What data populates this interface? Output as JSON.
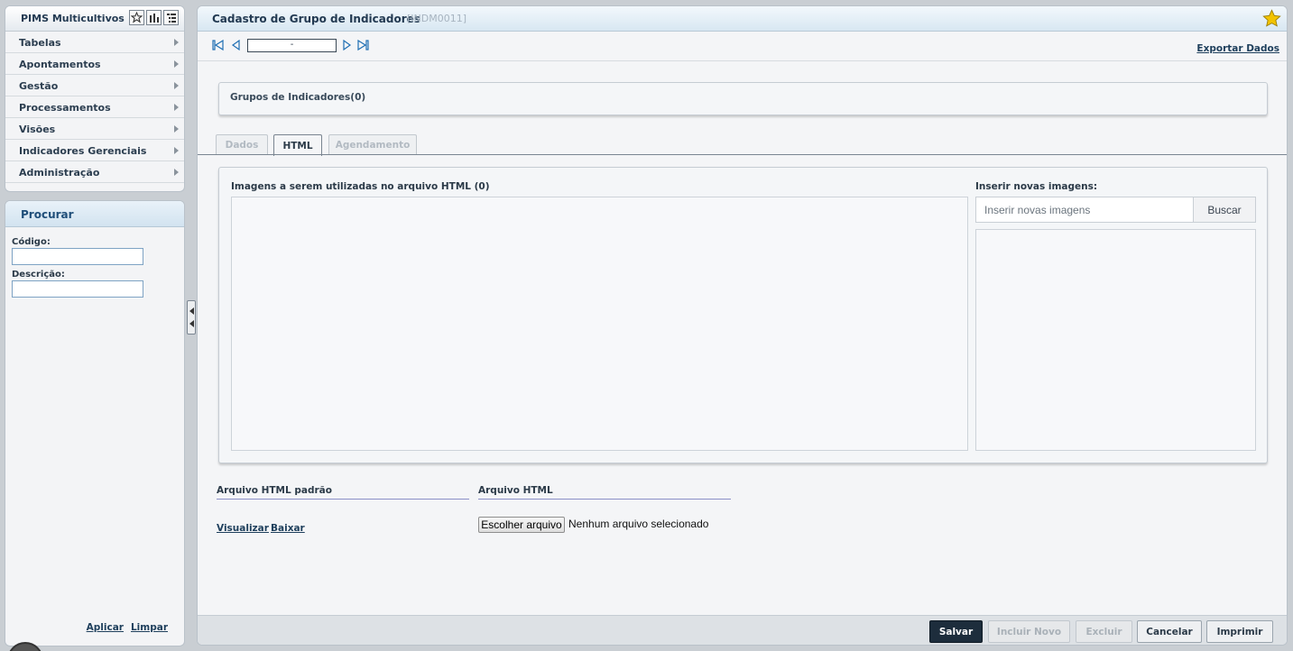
{
  "sidebar": {
    "app_title": "PIMS Multicultivos",
    "header_icons": [
      "star-icon",
      "bar-chart-icon",
      "tree-list-icon"
    ],
    "menu": [
      {
        "label": "Tabelas"
      },
      {
        "label": "Apontamentos"
      },
      {
        "label": "Gestão"
      },
      {
        "label": "Processamentos"
      },
      {
        "label": "Visões"
      },
      {
        "label": "Indicadores Gerenciais"
      },
      {
        "label": "Administração"
      }
    ]
  },
  "search": {
    "title": "Procurar",
    "code_label": "Código:",
    "code_value": "",
    "description_label": "Descrição:",
    "description_value": "",
    "apply_label": "Aplicar",
    "clear_label": "Limpar"
  },
  "main": {
    "title": "Cadastro de Grupo de Indicadores",
    "code": "[INDM0011]",
    "record_value": "-",
    "export_label": "Exportar Dados",
    "groups_label": "Grupos de Indicadores(0)",
    "tabs": [
      {
        "label": "Dados",
        "active": false
      },
      {
        "label": "HTML",
        "active": true
      },
      {
        "label": "Agendamento",
        "active": false
      }
    ],
    "html_section": {
      "images_label": "Imagens a serem utilizadas no arquivo HTML (0)",
      "insert_label": "Inserir novas imagens:",
      "insert_placeholder": "Inserir novas imagens",
      "search_button": "Buscar"
    },
    "default_file_label": "Arquivo HTML padrão",
    "view_label": "Visualizar",
    "download_label": "Baixar",
    "file_label": "Arquivo HTML",
    "choose_file_button": "Escolher arquivo",
    "no_file_text": "Nenhum arquivo selecionado"
  },
  "footer": {
    "save": "Salvar",
    "include_new": "Incluir Novo",
    "delete": "Excluir",
    "cancel": "Cancelar",
    "print": "Imprimir"
  },
  "colors": {
    "primary_button": "#1d2d3c",
    "accent_blue": "#1f4e79",
    "star": "#f2c300"
  }
}
